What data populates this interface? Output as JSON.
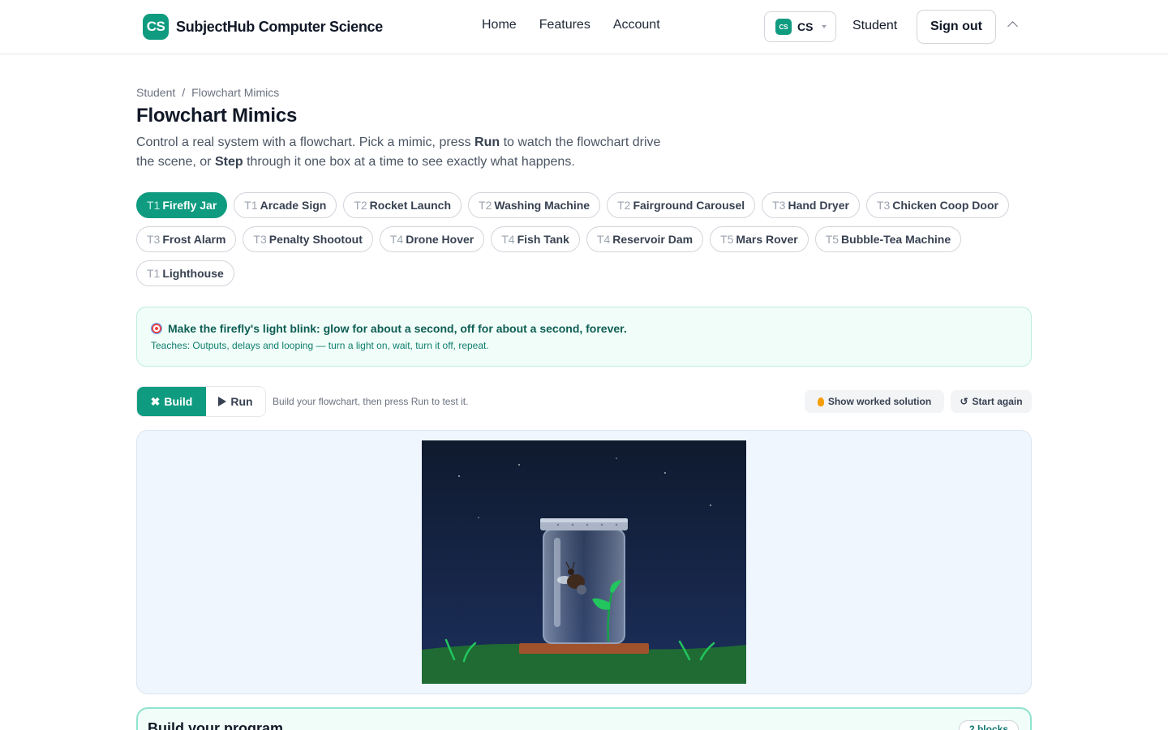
{
  "header": {
    "brand_logo": "CS",
    "brand_name": "SubjectHub Computer Science",
    "nav": [
      "Home",
      "Features",
      "Account"
    ],
    "subject_chip": "CS",
    "subject_label": "CS",
    "role": "Student",
    "signout_label": "Sign out"
  },
  "breadcrumb": {
    "root": "Student",
    "separator": "/",
    "current": "Flowchart Mimics"
  },
  "page_title": "Flowchart Mimics",
  "intro": {
    "part1": "Control a real system with a flowchart. Pick a mimic, press ",
    "run_word": "Run",
    "part2": " to watch the flowchart drive the scene, or ",
    "step_word": "Step",
    "part3": " through it one box at a time to see exactly what happens."
  },
  "mimics": [
    {
      "tier": "T1",
      "name": "Firefly Jar",
      "active": true
    },
    {
      "tier": "T1",
      "name": "Arcade Sign"
    },
    {
      "tier": "T2",
      "name": "Rocket Launch"
    },
    {
      "tier": "T2",
      "name": "Washing Machine"
    },
    {
      "tier": "T2",
      "name": "Fairground Carousel"
    },
    {
      "tier": "T3",
      "name": "Hand Dryer"
    },
    {
      "tier": "T3",
      "name": "Chicken Coop Door"
    },
    {
      "tier": "T3",
      "name": "Frost Alarm"
    },
    {
      "tier": "T3",
      "name": "Penalty Shootout"
    },
    {
      "tier": "T4",
      "name": "Drone Hover"
    },
    {
      "tier": "T4",
      "name": "Fish Tank"
    },
    {
      "tier": "T4",
      "name": "Reservoir Dam"
    },
    {
      "tier": "T5",
      "name": "Mars Rover"
    },
    {
      "tier": "T5",
      "name": "Bubble-Tea Machine"
    },
    {
      "tier": "T1",
      "name": "Lighthouse"
    }
  ],
  "goal": {
    "icon": "target-icon",
    "text": "Make the firefly's light blink: glow for about a second, off for about a second, forever.",
    "teaches": "Teaches: Outputs, delays and looping — turn a light on, wait, turn it off, repeat."
  },
  "toolbar": {
    "build_icon": "✖",
    "build_label": "Build",
    "run_label": "Run",
    "hint": "Build your flowchart, then press Run to test it.",
    "solution_label": "Show worked solution",
    "restart_icon": "↺",
    "restart_label": "Start again"
  },
  "program": {
    "title": "Build your program",
    "blocks_badge": "2 blocks"
  },
  "colors": {
    "accent": "#0f9b80",
    "night_sky": "#0f1a33",
    "grass": "#1f6b33",
    "jar_lid": "#aab4c6",
    "wood": "#a0522d"
  }
}
